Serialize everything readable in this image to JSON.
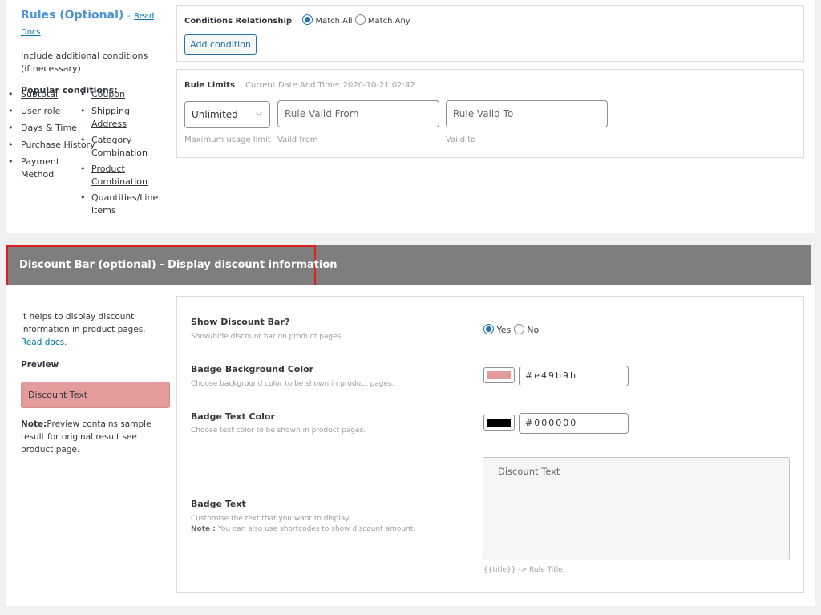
{
  "rules": {
    "title": "Rules (Optional)",
    "dash": "-",
    "read_docs": "Read Docs",
    "description": "Include additional conditions (if necessary)",
    "popular_title": "Popular conditions:",
    "left_list": [
      "Subtotal",
      "User role",
      "Days & Time",
      "Purchase History",
      "Payment Method"
    ],
    "right_list": [
      "Coupon",
      "Shipping Address",
      "Category Combination",
      "Product Combination",
      "Quantities/Line items"
    ]
  },
  "conditions": {
    "relationship_label": "Conditions Relationship",
    "match_all": "Match All",
    "match_any": "Match Any",
    "add_button": "Add condition"
  },
  "limits": {
    "title": "Rule Limits",
    "current_date": "Current Date And Time: 2020-10-21 02:42",
    "usage_value": "Unlimited",
    "valid_from_placeholder": "Rule Vaild From",
    "valid_to_placeholder": "Rule Valid To",
    "usage_caption": "Maximum usage limit",
    "from_caption": "Vaild from",
    "to_caption": "Vaild to"
  },
  "discount_bar": {
    "header": "Discount Bar (optional) - Display discount information",
    "help_prefix": "It helps to display discount information in product pages.",
    "help_link": "Read docs.",
    "preview_label": "Preview",
    "preview_text": "Discount Text",
    "note_bold": "Note:",
    "note_text": "Preview contains sample result for original result see product page.",
    "show_label": "Show Discount Bar?",
    "show_desc": "Show/hide discount bar on product pages",
    "yes": "Yes",
    "no": "No",
    "bg_label": "Badge Background Color",
    "bg_desc": "Choose background color to be shown in product pages.",
    "bg_value": "#e49b9b",
    "text_color_label": "Badge Text Color",
    "text_color_desc": "Choose text color to be shown in product pages.",
    "text_color_value": "#000000",
    "badge_text_label": "Badge Text",
    "badge_text_desc": "Customise the text that you want to display.",
    "badge_note_bold": "Note :",
    "badge_note_text": "You can also use shortcodes to show discount amount.",
    "badge_text_value": "Discount Text",
    "shortcode_hint": "{{title}} -> Rule Title,"
  },
  "colors": {
    "accent": "#2271b1",
    "badge_bg": "#e49b9b",
    "badge_text": "#000000",
    "header_bg": "#7e7e7e",
    "highlight": "#e02020"
  }
}
